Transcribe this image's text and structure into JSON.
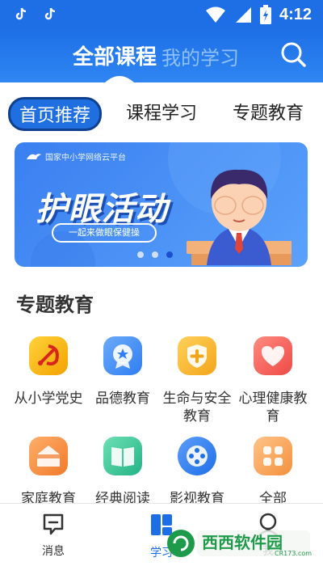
{
  "status_bar": {
    "time": "4:12"
  },
  "header": {
    "tab_active": "全部课程",
    "tab_inactive": "我的学习"
  },
  "category_tabs": [
    {
      "label": "首页推荐",
      "active": true
    },
    {
      "label": "课程学习",
      "active": false
    },
    {
      "label": "专题教育",
      "active": false
    }
  ],
  "banner": {
    "logo_text": "国家中小学网络云平台",
    "title": "护眼活动",
    "subtitle": "一起来做眼保健操",
    "slide_count": 3,
    "active_slide": 3
  },
  "section": {
    "title": "专题教育",
    "items": [
      {
        "label": "从小学党史",
        "icon": "party-emblem-icon",
        "color": "#f5b800"
      },
      {
        "label": "品德教育",
        "icon": "medal-icon",
        "color": "#3f8cf3"
      },
      {
        "label": "生命与安全教育",
        "icon": "shield-plus-icon",
        "color": "#f5b31c"
      },
      {
        "label": "心理健康教育",
        "icon": "heart-icon",
        "color": "#f25a55"
      },
      {
        "label": "家庭教育",
        "icon": "house-icon",
        "color": "#f2883a"
      },
      {
        "label": "经典阅读",
        "icon": "book-icon",
        "color": "#2fbf8e"
      },
      {
        "label": "影视教育",
        "icon": "film-reel-icon",
        "color": "#2f7ef3"
      },
      {
        "label": "全部",
        "icon": "grid-icon",
        "color": "#f6a35a"
      }
    ]
  },
  "bottom_nav": [
    {
      "label": "消息",
      "icon": "message-icon"
    },
    {
      "label": "学习",
      "icon": "study-icon"
    },
    {
      "label": "我",
      "icon": "profile-icon"
    }
  ],
  "watermark": {
    "text": "西西软件园",
    "sub": "CR173.com"
  }
}
